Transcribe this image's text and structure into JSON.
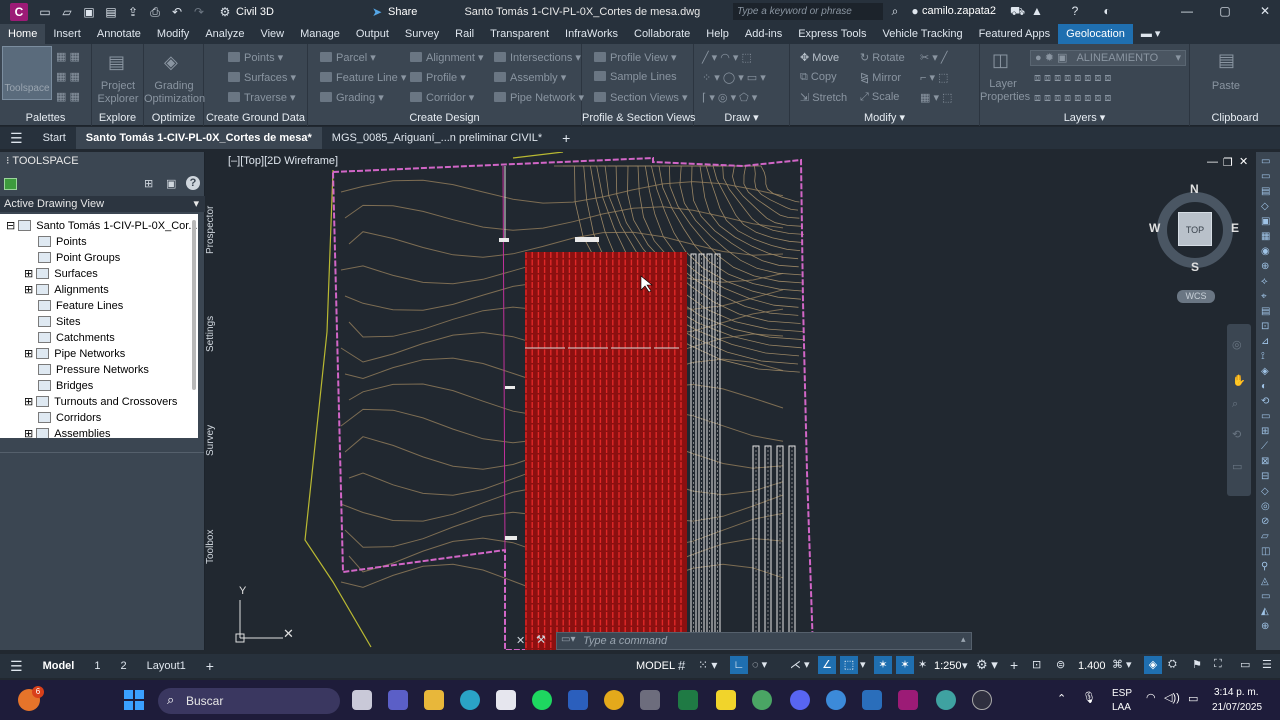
{
  "titlebar": {
    "workspace": "Civil 3D",
    "share_label": "Share",
    "document_title": "Santo Tomás 1-CIV-PL-0X_Cortes de mesa.dwg",
    "search_placeholder": "Type a keyword or phrase",
    "user": "camilo.zapata2"
  },
  "ribbon_tabs": [
    "Home",
    "Insert",
    "Annotate",
    "Modify",
    "Analyze",
    "View",
    "Manage",
    "Output",
    "Survey",
    "Rail",
    "Transparent",
    "InfraWorks",
    "Collaborate",
    "Help",
    "Add-ins",
    "Express Tools",
    "Vehicle Tracking",
    "Featured Apps",
    "Geolocation"
  ],
  "ribbon": {
    "big_buttons": [
      "Toolspace",
      "Project Explorer",
      "Grading Optimization",
      "Layer Properties",
      "Paste"
    ],
    "items": {
      "points": "Points",
      "surfaces": "Surfaces",
      "traverse": "Traverse",
      "parcel": "Parcel",
      "feature_line": "Feature Line",
      "grading": "Grading",
      "alignment": "Alignment",
      "profile": "Profile",
      "corridor": "Corridor",
      "intersections": "Intersections",
      "assembly": "Assembly",
      "pipe_network": "Pipe Network",
      "profile_view": "Profile View",
      "sample_lines": "Sample Lines",
      "section_views": "Section Views",
      "move": "Move",
      "copy": "Copy",
      "stretch": "Stretch",
      "rotate": "Rotate",
      "mirror": "Mirror",
      "scale": "Scale",
      "layer_name": "ALINEAMIENTO"
    },
    "panel_titles": [
      "Palettes",
      "Explore",
      "Optimize",
      "Create Ground Data",
      "Create Design",
      "Profile & Section Views",
      "Draw",
      "Modify",
      "Layers",
      "Clipboard"
    ]
  },
  "doc_tabs": [
    "Start",
    "Santo Tomás 1-CIV-PL-0X_Cortes de mesa*",
    "MGS_0085_Ariguaní_...n preliminar CIVIL*"
  ],
  "toolspace": {
    "title": "TOOLSPACE",
    "view_mode": "Active Drawing View",
    "root": "Santo Tomás 1-CIV-PL-0X_Cor...",
    "items": [
      "Points",
      "Point Groups",
      "Surfaces",
      "Alignments",
      "Feature Lines",
      "Sites",
      "Catchments",
      "Pipe Networks",
      "Pressure Networks",
      "Bridges",
      "Turnouts and Crossovers",
      "Corridors",
      "Assemblies"
    ],
    "side_tabs": [
      "Prospector",
      "Settings",
      "Survey",
      "Toolbox"
    ]
  },
  "viewport": {
    "label": "[–][Top][2D Wireframe]",
    "viewcube": {
      "n": "N",
      "s": "S",
      "e": "E",
      "w": "W",
      "top": "TOP",
      "wcs": "WCS"
    },
    "command_placeholder": "Type a command"
  },
  "statusbar": {
    "layout_tabs": [
      "Model",
      "1",
      "2",
      "Layout1"
    ],
    "model_label": "MODEL",
    "scale": "1:250",
    "zoom_value": "1.400"
  },
  "taskbar": {
    "search": "Buscar",
    "lang": "ESP",
    "lang2": "LAA",
    "time": "3:14 p. m.",
    "date": "21/07/2025",
    "badge": "6"
  },
  "colors": {
    "accent": "#1f6fb0",
    "array_red": "#cc1b1b",
    "boundary": "#d266c7",
    "contour": "#8a7a5e"
  }
}
